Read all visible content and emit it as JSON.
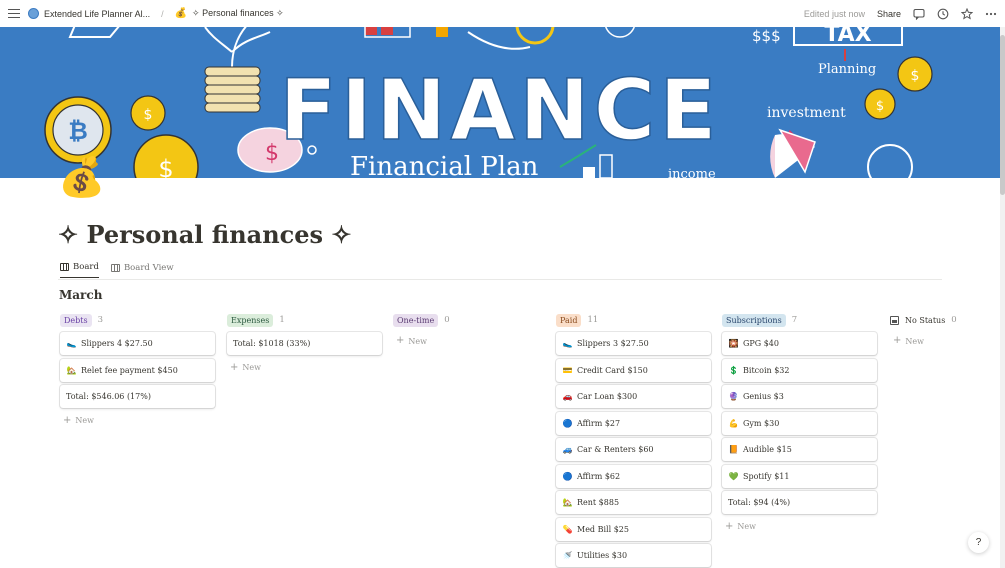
{
  "topbar": {
    "breadcrumb_1": "Extended Life Planner Al...",
    "breadcrumb_sep": "/",
    "breadcrumb_2": "✧ Personal finances ✧",
    "edited": "Edited just now",
    "share": "Share"
  },
  "cover": {
    "banner_text": "FINANCE",
    "labels": [
      "$$$",
      "TAX",
      "Planning",
      "investment",
      "Financial Plan",
      "income"
    ]
  },
  "page": {
    "icon": "💰",
    "title": "✧ Personal finances ✧",
    "tabs": [
      {
        "label": "Board",
        "active": true
      },
      {
        "label": "Board View",
        "active": false
      }
    ],
    "group": "March"
  },
  "columns": [
    {
      "label": "Debts",
      "count": "3",
      "tag_bg": "#eae4f2",
      "tag_fg": "#6940a5",
      "cards": [
        {
          "icon": "🥿",
          "text": "Slippers 4 $27.50"
        },
        {
          "icon": "🏡",
          "text": "Relet fee payment $450"
        },
        {
          "icon": "",
          "text": "Total: $546.06 (17%)"
        }
      ]
    },
    {
      "label": "Expenses",
      "count": "1",
      "tag_bg": "#dbeddb",
      "tag_fg": "#2b593f",
      "cards": [
        {
          "icon": "",
          "text": "Total: $1018 (33%)"
        }
      ]
    },
    {
      "label": "One-time",
      "count": "0",
      "tag_bg": "#e8deee",
      "tag_fg": "#5a3b72",
      "cards": []
    },
    {
      "label": "Paid",
      "count": "11",
      "tag_bg": "#fadec9",
      "tag_fg": "#8a4c1e",
      "cards": [
        {
          "icon": "🥿",
          "text": "Slippers 3 $27.50"
        },
        {
          "icon": "💳",
          "text": "Credit Card $150"
        },
        {
          "icon": "🚗",
          "text": "Car Loan $300"
        },
        {
          "icon": "🔵",
          "text": "Affirm $27"
        },
        {
          "icon": "🚙",
          "text": "Car & Renters $60"
        },
        {
          "icon": "🔵",
          "text": "Affirm $62"
        },
        {
          "icon": "🏡",
          "text": "Rent $885"
        },
        {
          "icon": "💊",
          "text": "Med Bill $25"
        },
        {
          "icon": "🚿",
          "text": "Utilities $30"
        }
      ]
    },
    {
      "label": "Subscriptions",
      "count": "7",
      "tag_bg": "#d3e5ef",
      "tag_fg": "#28456c",
      "cards": [
        {
          "icon": "🎇",
          "text": "GPG $40"
        },
        {
          "icon": "💲",
          "text": "Bitcoin $32"
        },
        {
          "icon": "🔮",
          "text": "Genius $3"
        },
        {
          "icon": "💪",
          "text": "Gym $30"
        },
        {
          "icon": "📙",
          "text": "Audible $15"
        },
        {
          "icon": "💚",
          "text": "Spotify $11"
        },
        {
          "icon": "",
          "text": "Total: $94 (4%)"
        }
      ]
    }
  ],
  "no_status": {
    "label": "No Status",
    "count": "0"
  },
  "new_label": "New",
  "help": "?"
}
